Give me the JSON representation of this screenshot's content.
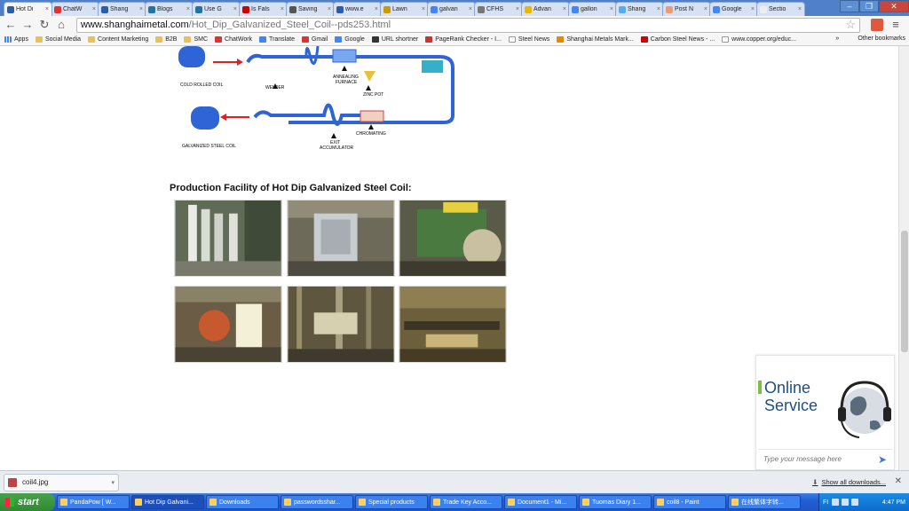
{
  "browser": {
    "tabs": [
      {
        "title": "Hot Di",
        "color": "#2b5ca8",
        "active": true
      },
      {
        "title": "ChatW",
        "color": "#d33"
      },
      {
        "title": "Shang",
        "color": "#2b5ca8"
      },
      {
        "title": "Blogs",
        "color": "#21759b"
      },
      {
        "title": "Use G",
        "color": "#21759b"
      },
      {
        "title": "Is Fals",
        "color": "#c00"
      },
      {
        "title": "Saving",
        "color": "#555"
      },
      {
        "title": "www.e",
        "color": "#2b5ca8"
      },
      {
        "title": "Lawn",
        "color": "#c90"
      },
      {
        "title": "galvan",
        "color": "#4285f4"
      },
      {
        "title": "CFHS",
        "color": "#777"
      },
      {
        "title": "Advan",
        "color": "#e6b800"
      },
      {
        "title": "gallon",
        "color": "#4285f4"
      },
      {
        "title": "Shang",
        "color": "#55acee"
      },
      {
        "title": "Post N",
        "color": "#e97"
      },
      {
        "title": "Google",
        "color": "#4285f4"
      },
      {
        "title": "Sectio",
        "color": "#eee"
      }
    ],
    "url_domain": "www.shanghaimetal.com",
    "url_path": "/Hot_Dip_Galvanized_Steel_Coil--pds253.html",
    "bookmarks": [
      {
        "label": "Apps",
        "kind": "apps"
      },
      {
        "label": "Social Media",
        "kind": "folder"
      },
      {
        "label": "Content Marketing",
        "kind": "folder"
      },
      {
        "label": "B2B",
        "kind": "folder"
      },
      {
        "label": "SMC",
        "kind": "folder"
      },
      {
        "label": "ChatWork",
        "kind": "site",
        "color": "#d33"
      },
      {
        "label": "Translate",
        "kind": "site",
        "color": "#4285f4"
      },
      {
        "label": "Gmail",
        "kind": "site",
        "color": "#d33"
      },
      {
        "label": "Google",
        "kind": "site",
        "color": "#4285f4"
      },
      {
        "label": "URL shortner",
        "kind": "site",
        "color": "#333"
      },
      {
        "label": "PageRank Checker - I...",
        "kind": "site",
        "color": "#c33"
      },
      {
        "label": "Steel News",
        "kind": "page"
      },
      {
        "label": "Shanghai Metals Mark...",
        "kind": "site",
        "color": "#e58a00"
      },
      {
        "label": "Carbon Steel News - ...",
        "kind": "site",
        "color": "#c00"
      },
      {
        "label": "www.copper.org/educ...",
        "kind": "page"
      }
    ],
    "other_bookmarks": "Other bookmarks",
    "more": "»"
  },
  "diagram": {
    "labels": {
      "cold_rolled_coil": "COLD ROLLED COIL",
      "welder": "WELDER",
      "annealing_1": "ANNEALING",
      "annealing_2": "FURNACE",
      "zinc_pot": "ZINC POT",
      "galvanized_coil": "GALVANIZED STEEL COIL",
      "exit_1": "EXIT",
      "exit_2": "ACCUMULATOR",
      "chromating": "CHROMATING"
    }
  },
  "content": {
    "section_title": "Production Facility of Hot Dip Galvanized Steel Coil:"
  },
  "service": {
    "line1": "Online",
    "line2": "Service",
    "placeholder": "Type your message here"
  },
  "downloads": {
    "file": "coil4.jpg",
    "show_all": "Show all downloads..."
  },
  "taskbar": {
    "start": "start",
    "tasks": [
      "PandaPow [ W...",
      "Hot Dip Galvani...",
      "Downloads",
      "passwordsshar...",
      "Special products",
      "Trade Key Acco...",
      "Document1 - Mi...",
      "Tuomas Diary 1...",
      "coil8 - Paint",
      "在线繁体字转..."
    ],
    "lang": "FI",
    "time": "4:47 PM"
  }
}
